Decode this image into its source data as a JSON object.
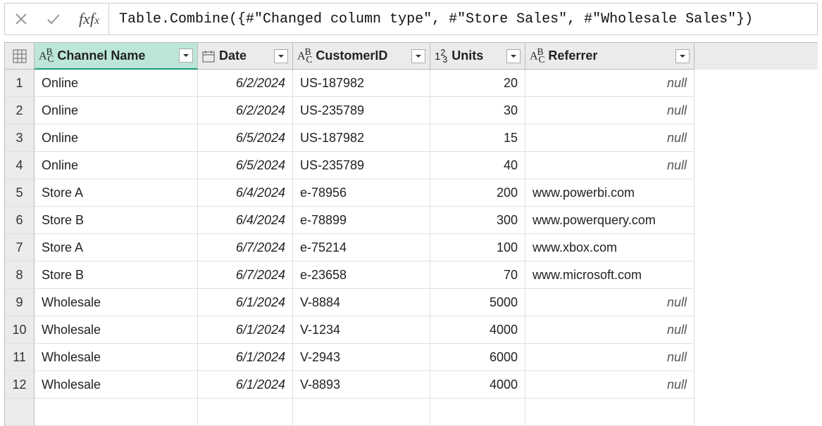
{
  "formula": "Table.Combine({#\"Changed column type\", #\"Store Sales\", #\"Wholesale Sales\"})",
  "fx_label": "fx",
  "null_label": "null",
  "columns": {
    "channel": {
      "label": "Channel Name",
      "type": "text"
    },
    "date": {
      "label": "Date",
      "type": "date"
    },
    "cust": {
      "label": "CustomerID",
      "type": "text"
    },
    "units": {
      "label": "Units",
      "type": "number"
    },
    "ref": {
      "label": "Referrer",
      "type": "text"
    }
  },
  "rows": [
    {
      "n": "1",
      "channel": "Online",
      "date": "6/2/2024",
      "cust": "US-187982",
      "units": "20",
      "ref": null
    },
    {
      "n": "2",
      "channel": "Online",
      "date": "6/2/2024",
      "cust": "US-235789",
      "units": "30",
      "ref": null
    },
    {
      "n": "3",
      "channel": "Online",
      "date": "6/5/2024",
      "cust": "US-187982",
      "units": "15",
      "ref": null
    },
    {
      "n": "4",
      "channel": "Online",
      "date": "6/5/2024",
      "cust": "US-235789",
      "units": "40",
      "ref": null
    },
    {
      "n": "5",
      "channel": "Store A",
      "date": "6/4/2024",
      "cust": "e-78956",
      "units": "200",
      "ref": "www.powerbi.com"
    },
    {
      "n": "6",
      "channel": "Store B",
      "date": "6/4/2024",
      "cust": "e-78899",
      "units": "300",
      "ref": "www.powerquery.com"
    },
    {
      "n": "7",
      "channel": "Store A",
      "date": "6/7/2024",
      "cust": "e-75214",
      "units": "100",
      "ref": "www.xbox.com"
    },
    {
      "n": "8",
      "channel": "Store B",
      "date": "6/7/2024",
      "cust": "e-23658",
      "units": "70",
      "ref": "www.microsoft.com"
    },
    {
      "n": "9",
      "channel": "Wholesale",
      "date": "6/1/2024",
      "cust": "V-8884",
      "units": "5000",
      "ref": null
    },
    {
      "n": "10",
      "channel": "Wholesale",
      "date": "6/1/2024",
      "cust": "V-1234",
      "units": "4000",
      "ref": null
    },
    {
      "n": "11",
      "channel": "Wholesale",
      "date": "6/1/2024",
      "cust": "V-2943",
      "units": "6000",
      "ref": null
    },
    {
      "n": "12",
      "channel": "Wholesale",
      "date": "6/1/2024",
      "cust": "V-8893",
      "units": "4000",
      "ref": null
    }
  ]
}
